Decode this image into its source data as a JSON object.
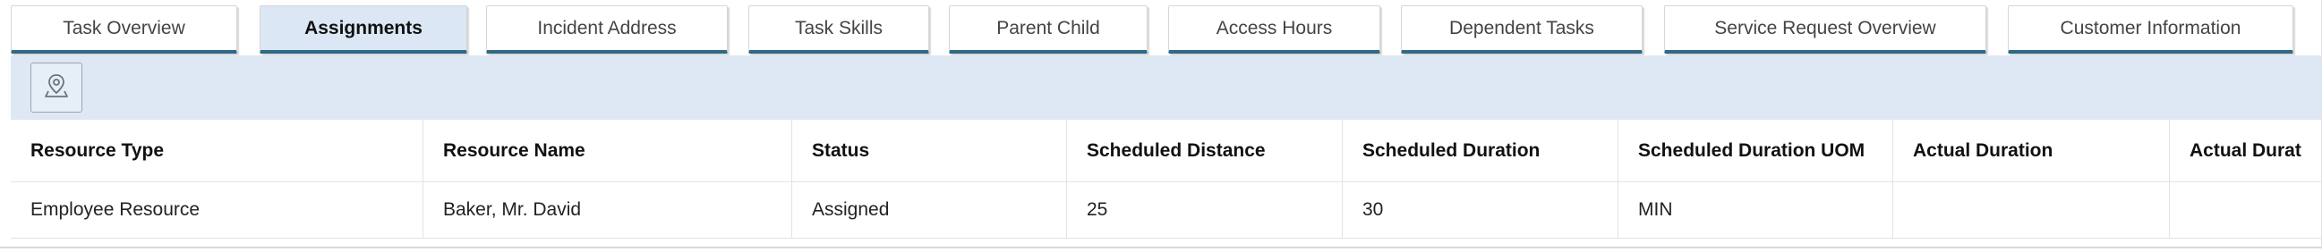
{
  "tabs": [
    {
      "label": "Task Overview",
      "active": false
    },
    {
      "label": "Assignments",
      "active": true
    },
    {
      "label": "Incident Address",
      "active": false
    },
    {
      "label": "Task Skills",
      "active": false
    },
    {
      "label": "Parent Child",
      "active": false
    },
    {
      "label": "Access Hours",
      "active": false
    },
    {
      "label": "Dependent Tasks",
      "active": false
    },
    {
      "label": "Service Request Overview",
      "active": false
    },
    {
      "label": "Customer Information",
      "active": false
    }
  ],
  "toolbar": {
    "map_button_icon": "map-pin-icon"
  },
  "table": {
    "columns": [
      "Resource Type",
      "Resource Name",
      "Status",
      "Scheduled Distance",
      "Scheduled Duration",
      "Scheduled Duration UOM",
      "Actual Duration",
      "Actual Durat"
    ],
    "rows": [
      [
        "Employee Resource",
        "Baker, Mr. David",
        "Assigned",
        "25",
        "30",
        "MIN",
        "",
        ""
      ]
    ]
  },
  "colors": {
    "tab_underline": "#2f6a87",
    "active_tab_bg": "#dbe7f4",
    "toolbar_bg": "#dde8f4"
  }
}
